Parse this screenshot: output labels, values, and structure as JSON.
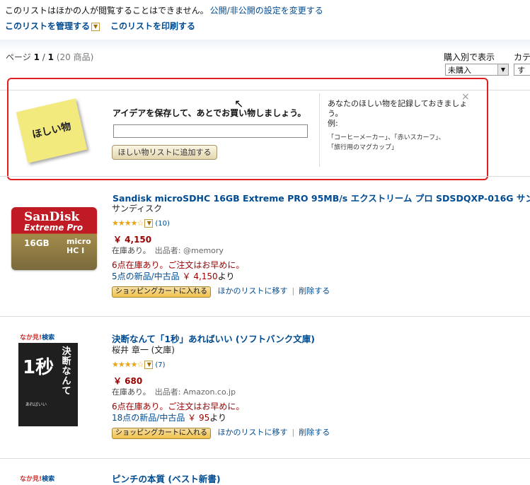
{
  "notice": {
    "text": "このリストはほかの人が閲覧することはできません。",
    "link": "公開/非公開の設定を変更する"
  },
  "manage_label": "このリストを管理する",
  "print_label": "このリストを印刷する",
  "pager": {
    "prefix": "ページ",
    "current": "1",
    "sep": "/",
    "total": "1",
    "count": "(20 商品)"
  },
  "sort": {
    "label": "購入別で表示",
    "value": "未購入"
  },
  "category": {
    "label": "カテ",
    "value": "す"
  },
  "wishbox": {
    "sticky_text": "ほしい物",
    "headline": "アイデアを保存して、あとでお買い物しましょう。",
    "input_value": "",
    "add_button": "ほしい物リストに追加する",
    "help_line1": "あなたのほしい物を記録しておきましょう。",
    "help_line2": "例:",
    "help_examples1": "「コーヒーメーカー」、「赤いスカーフ」、",
    "help_examples2": "「旅行用のマグカップ」",
    "close": "×"
  },
  "items": [
    {
      "title": "Sandisk microSDHC 16GB Extreme PRO 95MB/s エクストリーム プロ SDSDQXP-016G サン",
      "brand": "サンディスク",
      "stars": "★★★★☆",
      "reviews": "(10)",
      "price": "￥ 4,150",
      "stock_status": "在庫あり。",
      "seller": "出品者: @memory",
      "instock": "6点在庫あり。ご注文はお早めに。",
      "offers_link": "5点の新品/中古品",
      "offers_price": "￥ 4,150",
      "offers_suffix": "より",
      "cart_button": "ショッピングカートに入れる",
      "move_link": "ほかのリストに移す",
      "delete_link": "削除する",
      "image": {
        "brand": "SanDisk",
        "line": "Extreme Pro",
        "capacity": "16GB",
        "format": "micro HC I"
      }
    },
    {
      "title": "決断なんて「1秒」あればいい (ソフトバンク文庫)",
      "brand": "桜井 章一 (文庫)",
      "stars": "★★★★☆",
      "reviews": "(7)",
      "price": "￥ 680",
      "stock_status": "在庫あり。",
      "seller": "出品者: Amazon.co.jp",
      "instock": "6点在庫あり。ご注文はお早めに。",
      "offers_link": "18点の新品/中古品",
      "offers_price": "￥ 95",
      "offers_suffix": "より",
      "cart_button": "ショッピングカートに入れる",
      "move_link": "ほかのリストに移す",
      "delete_link": "削除する",
      "image": {
        "header_a": "なか見!",
        "header_b": "検索",
        "title_v": "決断なんて",
        "title_big": "1秒",
        "title_end": "あればいい"
      }
    },
    {
      "title": "ピンチの本質 (ベスト新書)",
      "image": {
        "header_a": "なか見!",
        "header_b": "検索"
      }
    }
  ]
}
